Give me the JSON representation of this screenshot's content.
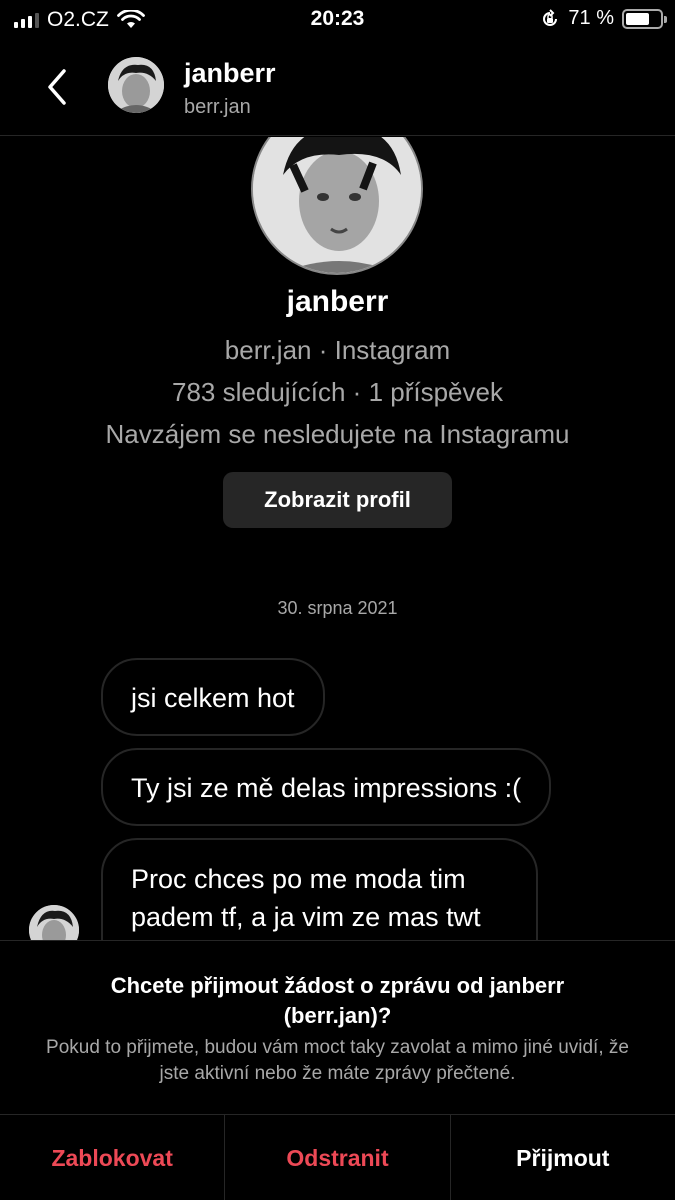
{
  "status_bar": {
    "carrier": "O2.CZ",
    "time": "20:23",
    "battery_percent": "71 %",
    "battery_level": 0.71,
    "icons": [
      "signal-icon",
      "wifi-icon",
      "orientation-lock-icon",
      "battery-icon"
    ]
  },
  "header": {
    "name": "janberr",
    "handle": "berr.jan"
  },
  "profile": {
    "name": "janberr",
    "line1": "berr.jan · Instagram",
    "line2": "783 sledujících · 1 příspěvek",
    "line3": "Navzájem se nesledujete na Instagramu",
    "view_profile_label": "Zobrazit profil"
  },
  "thread": {
    "date": "30. srpna 2021",
    "messages": [
      "jsi celkem hot",
      "Ty jsi ze mě delas impressions :(",
      "Proc chces po me moda tim padem tf, a ja vim ze mas twt"
    ]
  },
  "request": {
    "title": "Chcete přijmout žádost o zprávu od janberr (berr.jan)?",
    "description": "Pokud to přijmete, budou vám moct taky zavolat a mimo jiné uvidí, že jste aktivní nebo že máte zprávy přečtené.",
    "actions": {
      "block": "Zablokovat",
      "delete": "Odstranit",
      "accept": "Přijmout"
    }
  },
  "colors": {
    "background": "#000000",
    "danger": "#ed4956",
    "secondary_text": "#a8a8a8",
    "border": "#262626"
  }
}
